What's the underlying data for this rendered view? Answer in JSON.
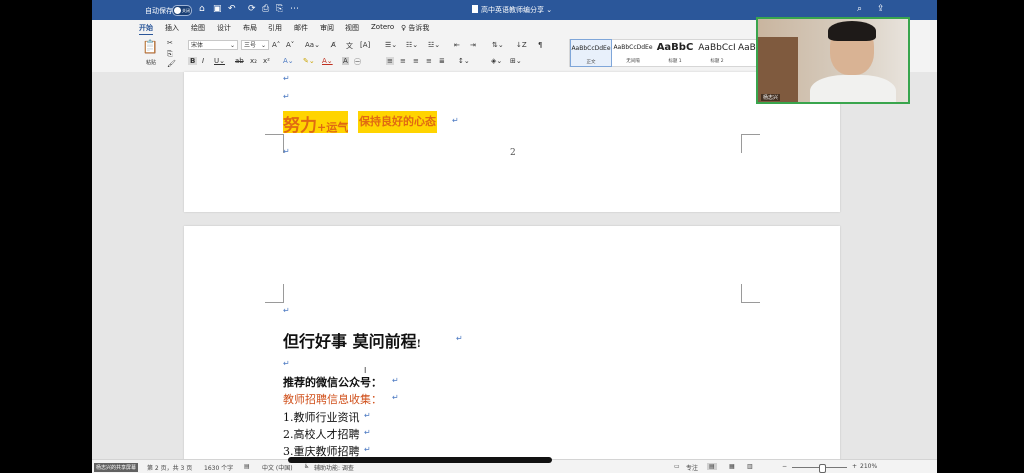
{
  "titlebar": {
    "autosave_label": "自动保存",
    "autosave_state": "关闭",
    "quick_access": [
      "⌂",
      "▣",
      "↶",
      "⟳",
      "⎙",
      "⎘",
      "⋯"
    ],
    "document_title": "高中英语教师编分享",
    "search_icon": "search-icon",
    "share_icon": "share-icon"
  },
  "menu": {
    "tabs": [
      "开始",
      "插入",
      "绘图",
      "设计",
      "布局",
      "引用",
      "邮件",
      "审阅",
      "视图",
      "Zotero"
    ],
    "tell_me": "告诉我"
  },
  "ribbon": {
    "paste_label": "粘贴",
    "font_name": "宋体",
    "font_size": "三号",
    "styles": [
      {
        "sample": "AaBbCcDdEe",
        "name": "正文"
      },
      {
        "sample": "AaBbCcDdEe",
        "name": "无间隔"
      },
      {
        "sample": "AaBbC",
        "name": "标题 1"
      },
      {
        "sample": "AaBbCcI",
        "name": "标题 2"
      },
      {
        "sample": "AaBl",
        "name": ""
      }
    ]
  },
  "page1": {
    "motto_big": "努力",
    "motto_small": "+运气",
    "motto_2": "保持良好的心态",
    "page_number": "2"
  },
  "page2": {
    "heading": "但行好事 莫问前程",
    "heading_punct": "!",
    "recommend": "推荐的微信公众号：",
    "recruit": "教师招聘信息收集：",
    "items": [
      "1.教师行业资讯",
      "2.高校人才招聘",
      "3.重庆教师招聘"
    ]
  },
  "status": {
    "page_info": "第 2 页，共 3 页",
    "word_count": "1630 个字",
    "language": "中文 (中国)",
    "accessibility": "辅助功能: 调查",
    "focus": "专注",
    "zoom": "210%"
  },
  "webcam": {
    "name_label": "杨志兴",
    "share_badge": "杨志兴的共享屏幕"
  },
  "colors": {
    "titlebar": "#2b579a",
    "highlight": "#ffd400",
    "motto_text": "#e06a12",
    "recruit_text": "#d0501b",
    "webcam_border": "#39a54d"
  }
}
